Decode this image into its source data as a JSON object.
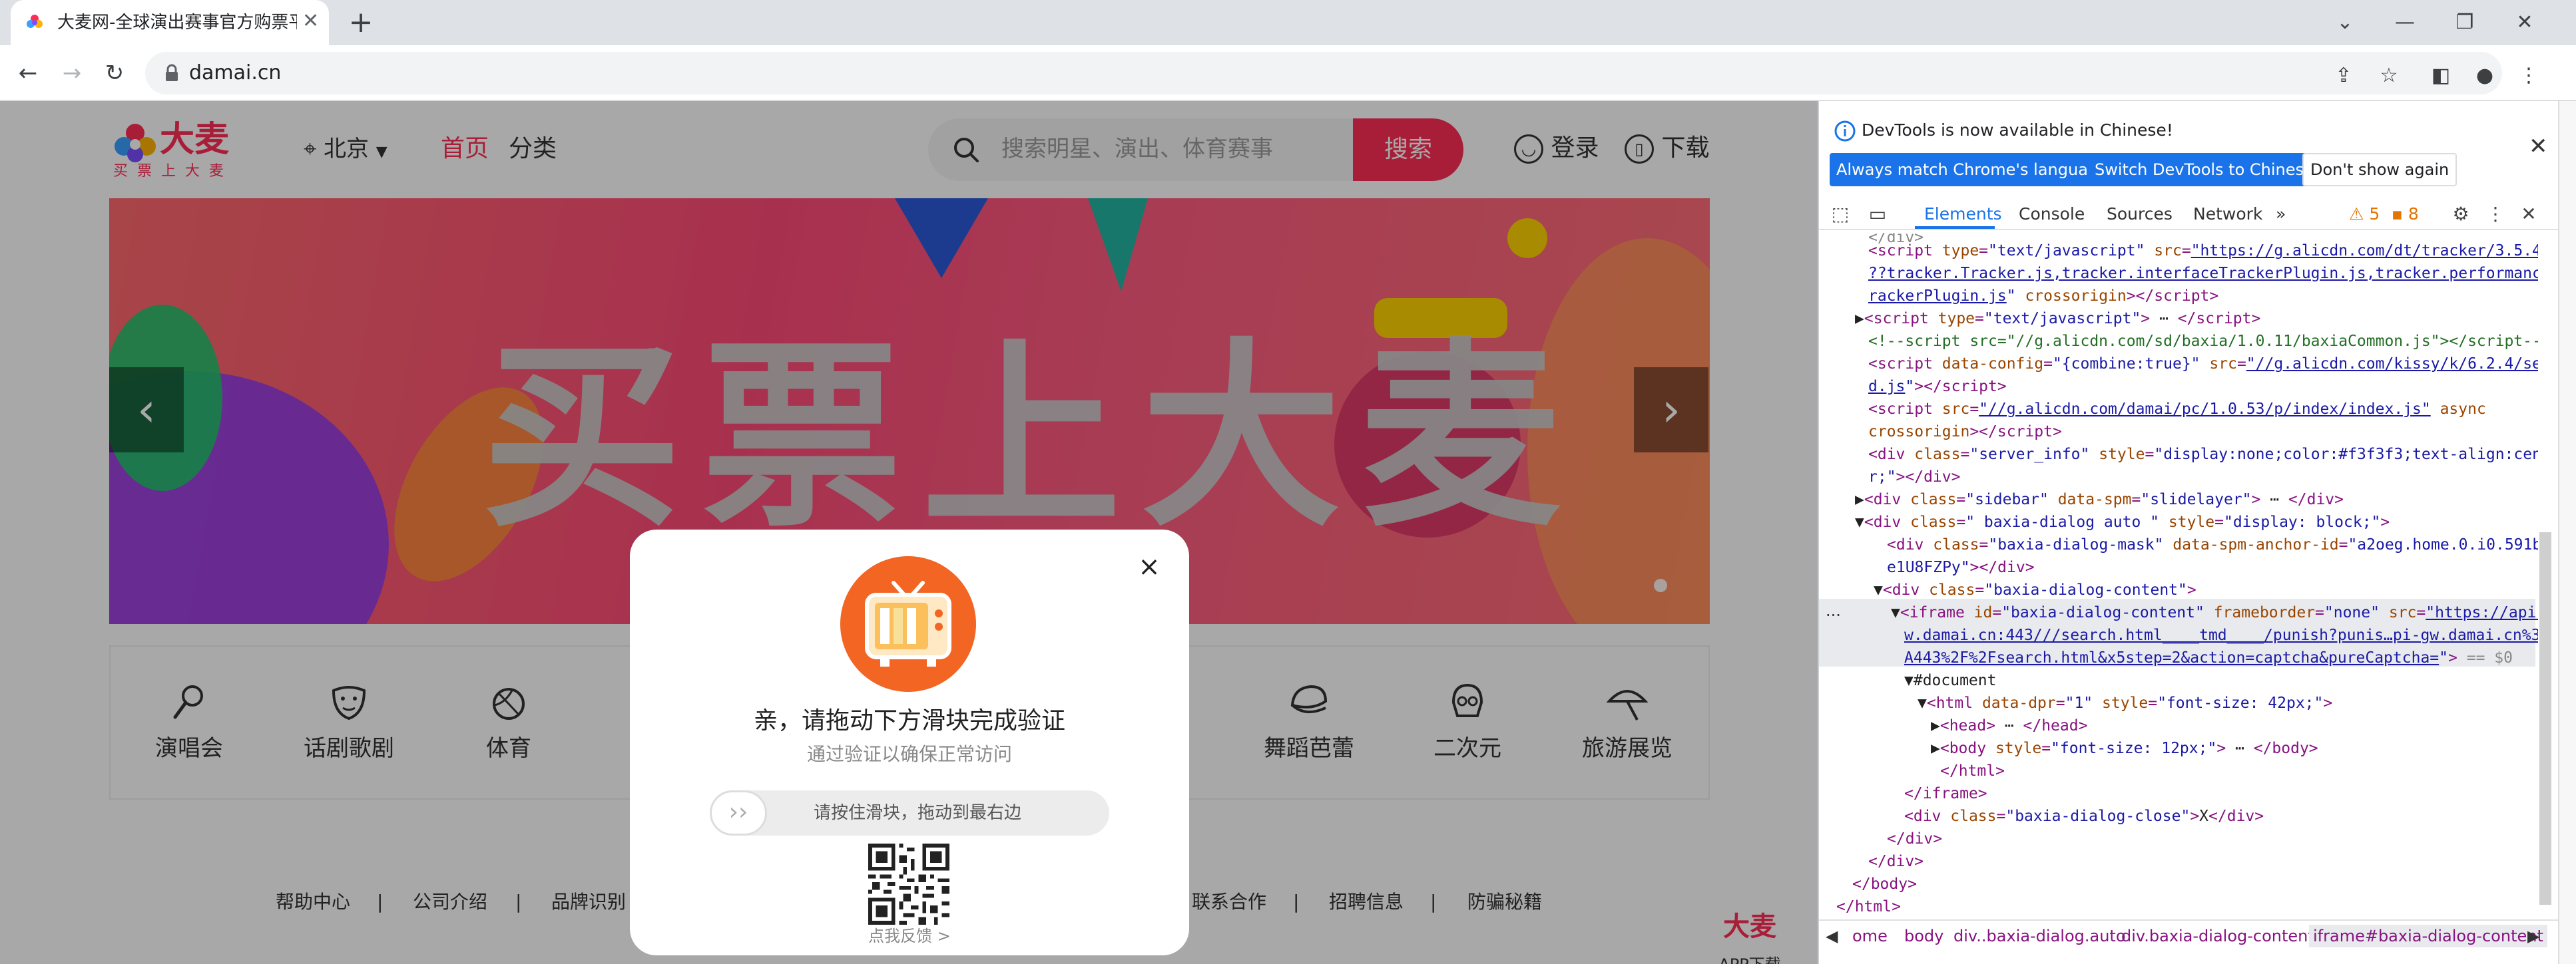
{
  "browser": {
    "tab_title": "大麦网-全球演出赛事官方购票平台",
    "tab_close": "✕",
    "new_tab": "+",
    "url": "damai.cn",
    "window_controls": {
      "collapse": "⌄",
      "minimize": "—",
      "restore": "❐",
      "close": "✕"
    }
  },
  "site": {
    "logo_text": "大麦",
    "logo_sub": "买票上大麦",
    "city": "北京",
    "nav": {
      "home": "首页",
      "category": "分类"
    },
    "search_placeholder": "搜索明星、演出、体育赛事",
    "search_button": "搜索",
    "login": "登录",
    "download": "下载",
    "banner_text": "买票上大麦",
    "banner_prev": "‹",
    "banner_next": "›",
    "categories": [
      {
        "label": "演唱会",
        "icon": "microphone-icon"
      },
      {
        "label": "话剧歌剧",
        "icon": "drama-mask-icon"
      },
      {
        "label": "体育",
        "icon": "ball-icon"
      },
      {
        "label": "舞蹈芭蕾",
        "icon": "ballet-hat-icon"
      },
      {
        "label": "二次元",
        "icon": "skull-mask-icon"
      },
      {
        "label": "旅游展览",
        "icon": "umbrella-icon"
      }
    ],
    "footer_links": [
      "帮助中心",
      "公司介绍",
      "品牌识别",
      "联系合作",
      "招聘信息",
      "防骗秘籍"
    ],
    "footer_sep": "|",
    "app_box": {
      "title": "大麦",
      "sub": "APP下载"
    }
  },
  "dialog": {
    "close": "×",
    "title": "亲，请拖动下方滑块完成验证",
    "subtitle": "通过验证以确保正常访问",
    "slider_hint": "请按住滑块，拖动到最右边",
    "slider_knob": "››",
    "feedback": "点我反馈 >"
  },
  "devtools": {
    "info_message": "DevTools is now available in Chinese!",
    "info_close": "✕",
    "btn_match": "Always match Chrome's language",
    "btn_switch": "Switch DevTools to Chinese",
    "btn_dont": "Don't show again",
    "tabs": [
      "Elements",
      "Console",
      "Sources",
      "Network"
    ],
    "more_tabs": "»",
    "warnings": "5",
    "errors": "8",
    "breadcrumbs": [
      "ome",
      "body",
      "div..baxia-dialog.auto",
      "div.baxia-dialog-content",
      "iframe#baxia-dialog-content"
    ],
    "selected_suffix": "== $0",
    "ellipsis": "..."
  },
  "colors": {
    "brand": "#ff2d55",
    "devtools_blue": "#1a73e8"
  }
}
